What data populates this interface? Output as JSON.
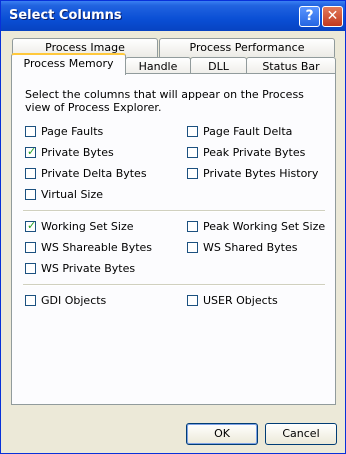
{
  "window": {
    "title": "Select Columns",
    "help_label": "?",
    "close_label": "✕"
  },
  "tabs": {
    "back_row": [
      "Process Image",
      "Process Performance"
    ],
    "front_row": [
      "Process Memory",
      "Handle",
      "DLL",
      "Status Bar"
    ],
    "active": "Process Memory"
  },
  "description": "Select the columns that will appear on the Process view of Process Explorer.",
  "options": {
    "page_faults": {
      "label": "Page Faults",
      "checked": false
    },
    "page_fault_delta": {
      "label": "Page Fault Delta",
      "checked": false
    },
    "private_bytes": {
      "label": "Private Bytes",
      "checked": true
    },
    "peak_private_bytes": {
      "label": "Peak Private Bytes",
      "checked": false
    },
    "private_delta_bytes": {
      "label": "Private Delta Bytes",
      "checked": false
    },
    "private_bytes_history": {
      "label": "Private Bytes History",
      "checked": false
    },
    "virtual_size": {
      "label": "Virtual Size",
      "checked": false
    },
    "working_set_size": {
      "label": "Working Set Size",
      "checked": true
    },
    "peak_working_set_size": {
      "label": "Peak Working Set Size",
      "checked": false
    },
    "ws_shareable_bytes": {
      "label": "WS Shareable Bytes",
      "checked": false
    },
    "ws_shared_bytes": {
      "label": "WS Shared Bytes",
      "checked": false
    },
    "ws_private_bytes": {
      "label": "WS Private Bytes",
      "checked": false
    },
    "gdi_objects": {
      "label": "GDI Objects",
      "checked": false
    },
    "user_objects": {
      "label": "USER Objects",
      "checked": false
    }
  },
  "buttons": {
    "ok": "OK",
    "cancel": "Cancel"
  },
  "colors": {
    "titlebar": "#0a4fd5",
    "accent_tab": "#ffc83c",
    "check": "#21a121"
  }
}
